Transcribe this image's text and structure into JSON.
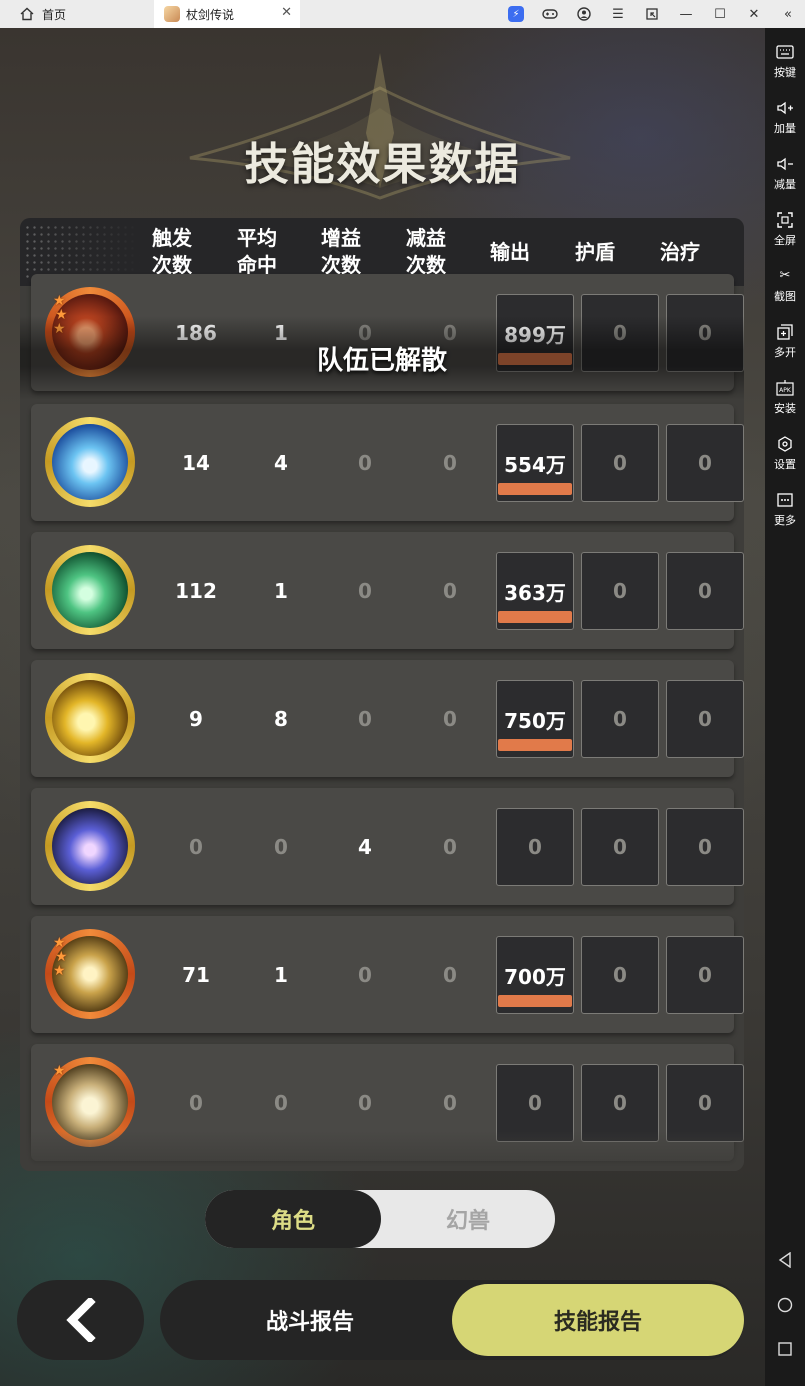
{
  "titlebar": {
    "home_label": "首页",
    "tab_label": "杖剑传说",
    "tab_close": "✕",
    "controls": [
      "boost",
      "gamepad",
      "account",
      "menu",
      "shrink",
      "minimize",
      "maximize",
      "close",
      "collapse"
    ]
  },
  "sidebar": {
    "items": [
      {
        "label": "按键",
        "icon": "keyboard-icon"
      },
      {
        "label": "加量",
        "icon": "volume-up-icon"
      },
      {
        "label": "减量",
        "icon": "volume-down-icon"
      },
      {
        "label": "全屏",
        "icon": "fullscreen-icon"
      },
      {
        "label": "截图",
        "icon": "scissors-icon"
      },
      {
        "label": "多开",
        "icon": "multi-instance-icon"
      },
      {
        "label": "安装",
        "icon": "apk-install-icon"
      },
      {
        "label": "设置",
        "icon": "settings-icon"
      },
      {
        "label": "更多",
        "icon": "more-icon"
      }
    ],
    "nav": [
      "back-triangle-icon",
      "home-circle-icon",
      "recents-square-icon"
    ]
  },
  "page": {
    "title": "技能效果数据"
  },
  "table": {
    "headers": [
      {
        "line1": "触发",
        "line2": "次数"
      },
      {
        "line1": "平均",
        "line2": "命中"
      },
      {
        "line1": "增益",
        "line2": "次数"
      },
      {
        "line1": "减益",
        "line2": "次数"
      },
      {
        "line1": "输出",
        "line2": ""
      },
      {
        "line1": "护盾",
        "line2": ""
      },
      {
        "line1": "治疗",
        "line2": ""
      }
    ],
    "rows": [
      {
        "icon": "meteor-skill-icon",
        "ring": "orange",
        "stars": 3,
        "trigger": "186",
        "hit": "1",
        "buff": "0",
        "debuff": "0",
        "output": "899万",
        "output_fill": 1,
        "shield": "0",
        "heal": "0"
      },
      {
        "icon": "ice-crystal-skill-icon",
        "ring": "gold",
        "stars": 0,
        "trigger": "14",
        "hit": "4",
        "buff": "0",
        "debuff": "0",
        "output": "554万",
        "output_fill": 1,
        "shield": "0",
        "heal": "0"
      },
      {
        "icon": "wind-leaf-skill-icon",
        "ring": "gold",
        "stars": 0,
        "trigger": "112",
        "hit": "1",
        "buff": "0",
        "debuff": "0",
        "output": "363万",
        "output_fill": 1,
        "shield": "0",
        "heal": "0"
      },
      {
        "icon": "lightning-beast-skill-icon",
        "ring": "gold",
        "stars": 0,
        "trigger": "9",
        "hit": "8",
        "buff": "0",
        "debuff": "0",
        "output": "750万",
        "output_fill": 1,
        "shield": "0",
        "heal": "0"
      },
      {
        "icon": "star-circle-skill-icon",
        "ring": "gold",
        "stars": 0,
        "trigger": "0",
        "hit": "0",
        "buff": "4",
        "debuff": "0",
        "output": "0",
        "output_fill": 0,
        "shield": "0",
        "heal": "0"
      },
      {
        "icon": "golden-burst-skill-icon",
        "ring": "orange",
        "stars": 3,
        "trigger": "71",
        "hit": "1",
        "buff": "0",
        "debuff": "0",
        "output": "700万",
        "output_fill": 1,
        "shield": "0",
        "heal": "0"
      },
      {
        "icon": "rising-arrow-skill-icon",
        "ring": "orange",
        "stars": 1,
        "trigger": "0",
        "hit": "0",
        "buff": "0",
        "debuff": "0",
        "output": "0",
        "output_fill": 0,
        "shield": "0",
        "heal": "0"
      }
    ]
  },
  "overlay": {
    "message": "队伍已解散"
  },
  "toggle": {
    "active": "角色",
    "inactive": "幻兽"
  },
  "bottom": {
    "back_icon": "chevron-left-icon",
    "battle_report": "战斗报告",
    "skill_report": "技能报告"
  },
  "colors": {
    "accent_yellow": "#d6d675",
    "output_bar": "#e17a4a",
    "ring_gold": "#e8c23a",
    "ring_orange": "#e06a2a"
  }
}
